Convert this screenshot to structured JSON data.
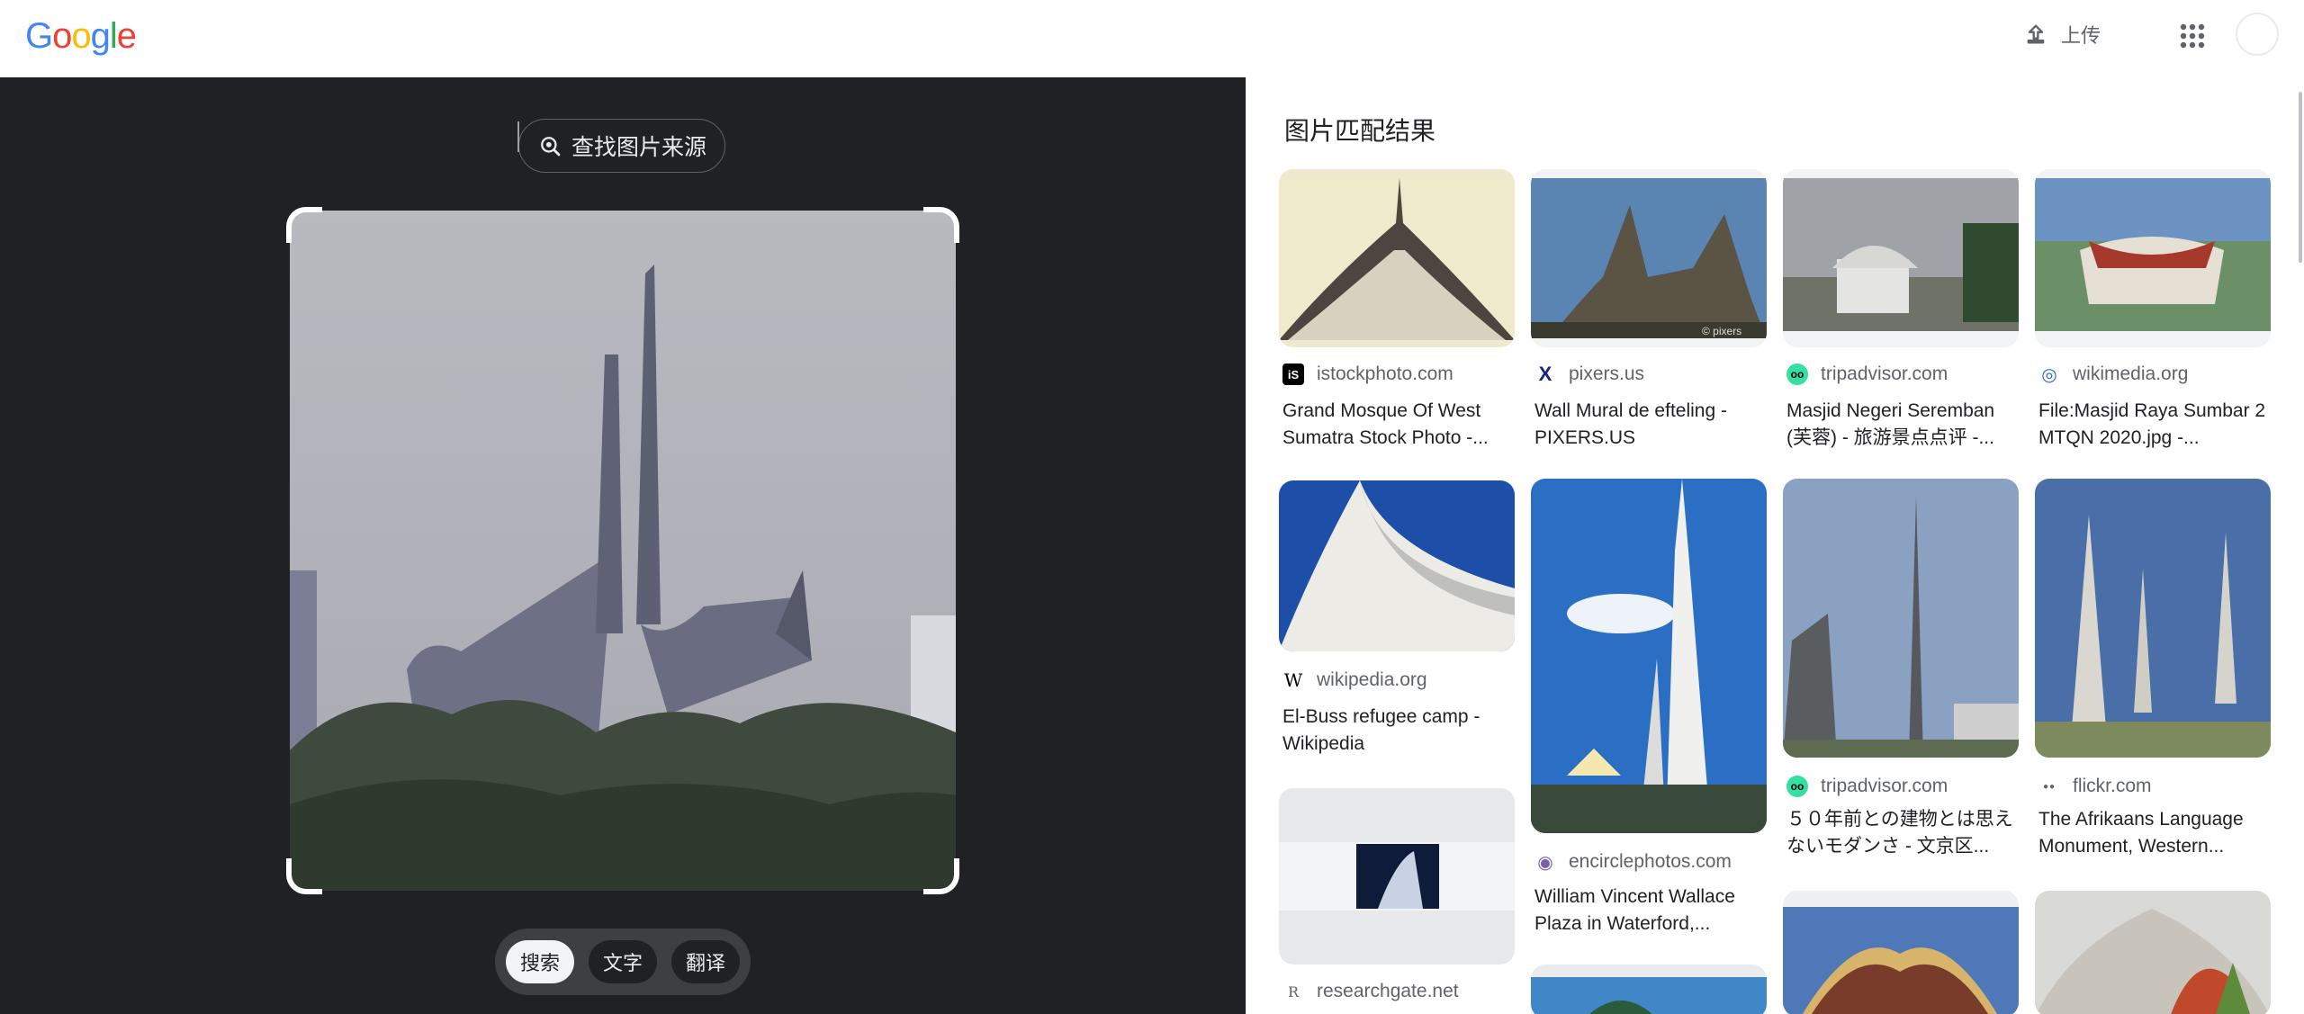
{
  "header": {
    "logo_letters": [
      {
        "ch": "G",
        "color": "#4285F4"
      },
      {
        "ch": "o",
        "color": "#EA4335"
      },
      {
        "ch": "o",
        "color": "#FBBC05"
      },
      {
        "ch": "g",
        "color": "#4285F4"
      },
      {
        "ch": "l",
        "color": "#34A853"
      },
      {
        "ch": "e",
        "color": "#EA4335"
      }
    ],
    "upload_label": "上传"
  },
  "left": {
    "find_source_label": "查找图片来源",
    "modes": [
      "搜索",
      "文字",
      "翻译"
    ],
    "active_mode": "搜索"
  },
  "results": {
    "title": "图片匹配结果",
    "items": [
      {
        "source": "istockphoto.com",
        "title": "Grand Mosque Of West Sumatra Stock Photo -...",
        "favicon": "iS",
        "favicon_color": "#000000"
      },
      {
        "source": "pixers.us",
        "title": "Wall Mural de efteling - PIXERS.US",
        "favicon": "X",
        "favicon_color": "#1a237e"
      },
      {
        "source": "tripadvisor.com",
        "title": "Masjid Negeri Seremban (芙蓉) - 旅游景点点评 -...",
        "favicon": "oo",
        "favicon_color": "#34e0a1"
      },
      {
        "source": "wikimedia.org",
        "title": "File:Masjid Raya Sumbar 2 MTQN 2020.jpg -...",
        "favicon": "◎",
        "favicon_color": "#3366cc"
      },
      {
        "source": "wikipedia.org",
        "title": "El-Buss refugee camp - Wikipedia",
        "favicon": "W",
        "favicon_color": "#000000"
      },
      {
        "source": "encirclephotos.com",
        "title": "William Vincent Wallace Plaza in Waterford,...",
        "favicon": "◉",
        "favicon_color": "#7b5ea7"
      },
      {
        "source": "tripadvisor.com",
        "title": "５０年前との建物とは思えないモダンさ - 文京区...",
        "favicon": "oo",
        "favicon_color": "#34e0a1"
      },
      {
        "source": "flickr.com",
        "title": "The Afrikaans Language Monument, Western...",
        "favicon": "●●",
        "favicon_color": "#0063dc"
      },
      {
        "source": "researchgate.net",
        "title": "",
        "favicon": "R",
        "favicon_color": "#000000"
      }
    ]
  }
}
